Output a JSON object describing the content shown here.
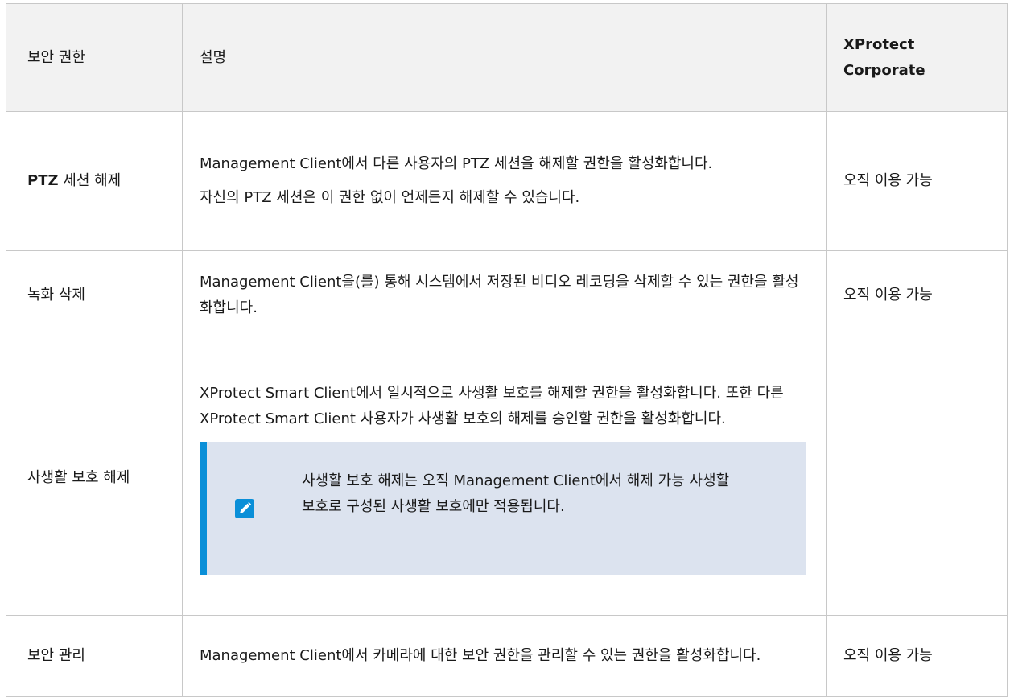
{
  "table": {
    "headers": [
      "보안 권한",
      "설명",
      "XProtect Corporate"
    ],
    "rows": [
      {
        "permission_bold": "PTZ",
        "permission_rest": " 세션 해제",
        "description_1": "Management Client에서 다른 사용자의 PTZ 세션을 해제할 권한을 활성화합니다.",
        "description_2": "자신의 PTZ 세션은 이 권한 없이 언제든지 해제할 수 있습니다.",
        "availability": "오직 이용 가능"
      },
      {
        "permission": "녹화 삭제",
        "description_1": "Management Client을(를) 통해 시스템에서 저장된 비디오 레코딩을 삭제할 수 있는 권한을 활성화합니다.",
        "availability": "오직 이용 가능"
      },
      {
        "permission": "사생활 보호 해제",
        "description_1": "XProtect Smart Client에서 일시적으로 사생활 보호를 해제할 권한을 활성화합니다. 또한 다른 XProtect Smart Client 사용자가 사생활 보호의 해제를 승인할 권한을 활성화합니다.",
        "note_icon": "pencil-icon",
        "note": "사생활 보호 해제는 오직 Management Client에서 해제 가능 사생활 보호로 구성된 사생활 보호에만 적용됩니다.",
        "availability": ""
      },
      {
        "permission": "보안 관리",
        "description_1": "Management Client에서 카메라에 대한 보안 권한을 관리할 수 있는 권한을 활성화합니다.",
        "availability": "오직 이용 가능"
      }
    ]
  },
  "colors": {
    "header_bg": "#f2f2f2",
    "note_bg": "#dce3ef",
    "accent": "#0a8fd8",
    "border": "#c8c8c8"
  }
}
